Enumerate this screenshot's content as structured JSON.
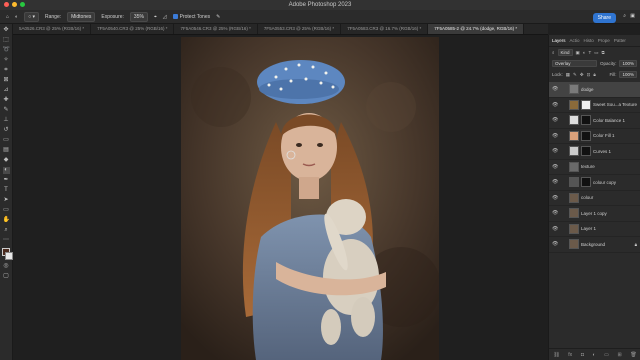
{
  "app": {
    "title": "Adobe Photoshop 2023"
  },
  "options_bar": {
    "range_label": "Range:",
    "range_value": "Midtones",
    "exposure_label": "Exposure:",
    "exposure_value": "35%",
    "protect_tones_label": "Protect Tones",
    "share_label": "Share"
  },
  "doc_tabs": [
    "5A0526.CR3 @ 25% (RGB/16) *",
    "7F5A0540.CR3 @ 25% (RGB/16) *",
    "7F5A0546.CR3 @ 25% (RGB/16) *",
    "7F5A0553.CR3 @ 25% (RGB/16) *",
    "7F5A0583.CR3 @ 16.7% (RGB/16) *",
    "7F5A0585-2 @ 24.7% (dodge, RGB/16) *"
  ],
  "panel": {
    "tabs": [
      "Layers",
      "Actio",
      "Histo",
      "Prope",
      "Patter"
    ],
    "kind_label": "Kind",
    "blend_mode": "Overlay",
    "opacity_label": "Opacity:",
    "opacity_value": "100%",
    "lock_label": "Lock:",
    "fill_label": "Fill:",
    "fill_value": "100%",
    "layers": [
      {
        "name": "dodge",
        "selected": true,
        "thumb": "#7a7a7a",
        "mask": ""
      },
      {
        "name": "Sweet Sou...a Texture",
        "selected": false,
        "thumb": "#8a6a3a",
        "mask": "#f0f0f0"
      },
      {
        "name": "Color Balance 1",
        "selected": false,
        "thumb": "#dddddd",
        "mask": "#111111"
      },
      {
        "name": "Color Fill 1",
        "selected": false,
        "thumb": "#d9a07a",
        "mask": "#111111"
      },
      {
        "name": "Curves 1",
        "selected": false,
        "thumb": "#cccccc",
        "mask": "#111111"
      },
      {
        "name": "texture",
        "selected": false,
        "thumb": "#6a6a6a",
        "mask": ""
      },
      {
        "name": "colour copy",
        "selected": false,
        "thumb": "#555555",
        "mask": "#111111"
      },
      {
        "name": "colour",
        "selected": false,
        "thumb": "#6b5a4a",
        "mask": ""
      },
      {
        "name": "Layer 1 copy",
        "selected": false,
        "thumb": "#6b5a4a",
        "mask": ""
      },
      {
        "name": "Layer 1",
        "selected": false,
        "thumb": "#6b5a4a",
        "mask": ""
      },
      {
        "name": "Background",
        "selected": false,
        "thumb": "#6b5a4a",
        "mask": ""
      }
    ]
  }
}
